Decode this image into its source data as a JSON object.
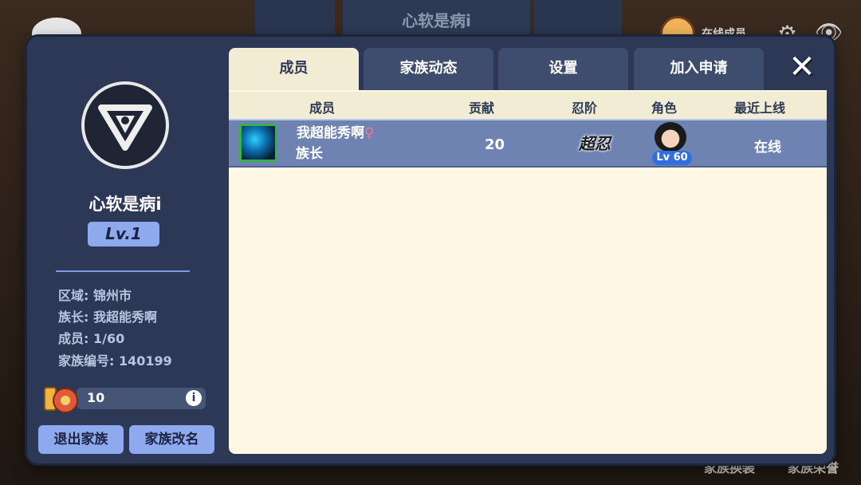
{
  "background": {
    "title": "心软是病i",
    "online_label": "在线成员",
    "bottom_right": [
      "家族换装",
      "家族荣誉"
    ]
  },
  "family": {
    "name": "心软是病i",
    "level": "Lv.1",
    "info": [
      {
        "label": "区域:",
        "value": "锦州市"
      },
      {
        "label": "族长:",
        "value": "我超能秀啊"
      },
      {
        "label": "成员:",
        "value": "1/60"
      },
      {
        "label": "家族编号:",
        "value": "140199"
      }
    ],
    "funds": "10",
    "buttons": {
      "quit": "退出家族",
      "rename": "家族改名"
    }
  },
  "tabs": [
    {
      "label": "成员",
      "active": true
    },
    {
      "label": "家族动态",
      "active": false
    },
    {
      "label": "设置",
      "active": false
    },
    {
      "label": "加入申请",
      "active": false
    }
  ],
  "table": {
    "headers": [
      "成员",
      "贡献",
      "忍阶",
      "角色",
      "最近上线"
    ],
    "rows": [
      {
        "name": "我超能秀啊",
        "gender": "♀",
        "role": "族长",
        "contribution": "20",
        "rank": "超忍",
        "char_level": "Lv 60",
        "last_online": "在线"
      }
    ]
  },
  "colors": {
    "panel": "#2c3856",
    "accent": "#8ea9ee",
    "content_bg": "#fdf7e3",
    "row_highlight": "#6e83b2"
  }
}
